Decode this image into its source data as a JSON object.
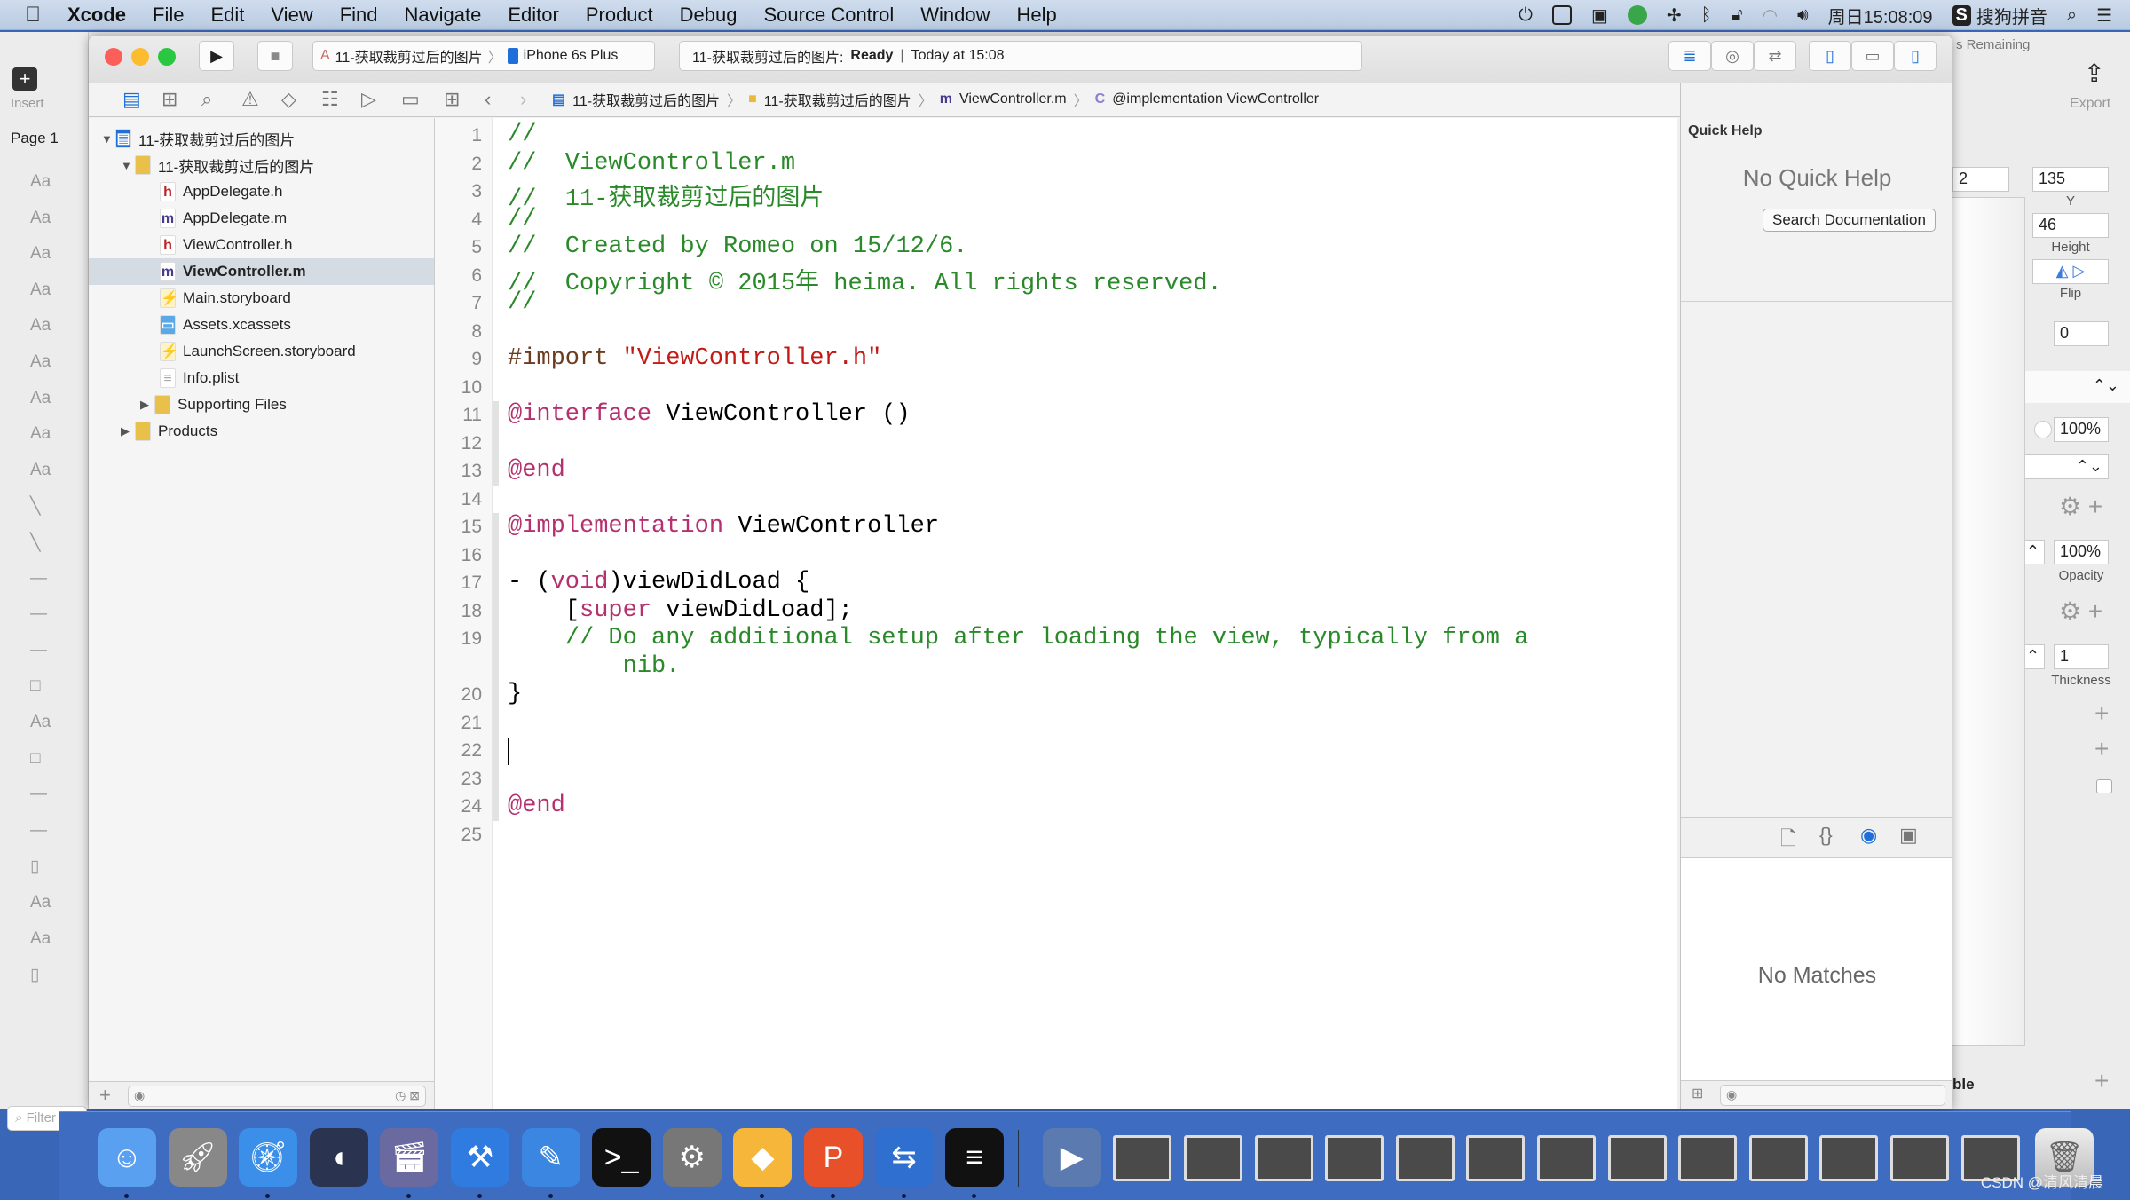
{
  "menubar": {
    "app": "Xcode",
    "items": [
      "File",
      "Edit",
      "View",
      "Find",
      "Navigate",
      "Editor",
      "Product",
      "Debug",
      "Source Control",
      "Window",
      "Help"
    ],
    "clock": "周日15:08:09",
    "ime": "搜狗拼音"
  },
  "sketch_left": {
    "insert": "Insert",
    "page": "Page 1",
    "filter_placeholder": "Filter",
    "aa": "Aa"
  },
  "sketch_right": {
    "remaining": "s Remaining",
    "export": "Export",
    "x_value": "2",
    "y_value": "135",
    "y_label": "Y",
    "height_value": "46",
    "height_label": "Height",
    "flip_label": "Flip",
    "radius_value": "0",
    "fill_opacity": "100%",
    "opacity_value": "100%",
    "opacity_label": "Opacity",
    "thickness_value": "1",
    "thickness_label": "Thickness",
    "bottom_label": "ble"
  },
  "toolbar": {
    "scheme": "11-获取裁剪过后的图片",
    "device": "iPhone 6s Plus",
    "status_project": "11-获取裁剪过后的图片:",
    "status_state": "Ready",
    "status_time": "Today at 15:08"
  },
  "jumpbar": {
    "crumbs": [
      "11-获取裁剪过后的图片",
      "11-获取裁剪过后的图片",
      "ViewController.m",
      "@implementation ViewController"
    ]
  },
  "navigator": {
    "items": [
      {
        "label": "11-获取裁剪过后的图片",
        "level": 0,
        "kind": "project",
        "open": true
      },
      {
        "label": "11-获取裁剪过后的图片",
        "level": 1,
        "kind": "folder",
        "open": true
      },
      {
        "label": "AppDelegate.h",
        "level": 2,
        "kind": "h"
      },
      {
        "label": "AppDelegate.m",
        "level": 2,
        "kind": "m"
      },
      {
        "label": "ViewController.h",
        "level": 2,
        "kind": "h"
      },
      {
        "label": "ViewController.m",
        "level": 2,
        "kind": "m",
        "selected": true
      },
      {
        "label": "Main.storyboard",
        "level": 2,
        "kind": "storyboard"
      },
      {
        "label": "Assets.xcassets",
        "level": 2,
        "kind": "assets"
      },
      {
        "label": "LaunchScreen.storyboard",
        "level": 2,
        "kind": "storyboard"
      },
      {
        "label": "Info.plist",
        "level": 2,
        "kind": "plist"
      },
      {
        "label": "Supporting Files",
        "level": 2,
        "kind": "folder",
        "open": false
      },
      {
        "label": "Products",
        "level": 1,
        "kind": "folder",
        "open": false
      }
    ]
  },
  "editor": {
    "lines": [
      {
        "n": "1",
        "t": [
          [
            "c",
            "//"
          ]
        ]
      },
      {
        "n": "2",
        "t": [
          [
            "c",
            "//  ViewController.m"
          ]
        ]
      },
      {
        "n": "3",
        "t": [
          [
            "c",
            "//  11-获取裁剪过后的图片"
          ]
        ]
      },
      {
        "n": "4",
        "t": [
          [
            "c",
            "//"
          ]
        ]
      },
      {
        "n": "5",
        "t": [
          [
            "c",
            "//  Created by Romeo on 15/12/6."
          ]
        ]
      },
      {
        "n": "6",
        "t": [
          [
            "c",
            "//  Copyright © 2015年 heima. All rights reserved."
          ]
        ]
      },
      {
        "n": "7",
        "t": [
          [
            "c",
            "//"
          ]
        ]
      },
      {
        "n": "8",
        "t": []
      },
      {
        "n": "9",
        "t": [
          [
            "p",
            "#import "
          ],
          [
            "s",
            "\"ViewController.h\""
          ]
        ]
      },
      {
        "n": "10",
        "t": []
      },
      {
        "n": "11",
        "t": [
          [
            "k",
            "@interface"
          ],
          [
            "n",
            " ViewController ()"
          ]
        ]
      },
      {
        "n": "12",
        "t": []
      },
      {
        "n": "13",
        "t": [
          [
            "k",
            "@end"
          ]
        ]
      },
      {
        "n": "14",
        "t": []
      },
      {
        "n": "15",
        "t": [
          [
            "k",
            "@implementation"
          ],
          [
            "n",
            " ViewController"
          ]
        ]
      },
      {
        "n": "16",
        "t": []
      },
      {
        "n": "17",
        "t": [
          [
            "n",
            "- ("
          ],
          [
            "k",
            "void"
          ],
          [
            "n",
            ")viewDidLoad {"
          ]
        ]
      },
      {
        "n": "18",
        "t": [
          [
            "n",
            "    ["
          ],
          [
            "k",
            "super"
          ],
          [
            "n",
            " viewDidLoad];"
          ]
        ]
      },
      {
        "n": "19",
        "t": [
          [
            "c",
            "    // Do any additional setup after loading the view, typically from a"
          ]
        ]
      },
      {
        "n": "",
        "t": [
          [
            "c",
            "        nib."
          ]
        ]
      },
      {
        "n": "20",
        "t": [
          [
            "n",
            "}"
          ]
        ]
      },
      {
        "n": "21",
        "t": []
      },
      {
        "n": "22",
        "t": [],
        "cursor": true
      },
      {
        "n": "23",
        "t": []
      },
      {
        "n": "24",
        "t": [
          [
            "k",
            "@end"
          ]
        ]
      },
      {
        "n": "25",
        "t": []
      }
    ]
  },
  "inspector": {
    "title": "Quick Help",
    "empty": "No Quick Help",
    "search_button": "Search Documentation",
    "library_empty": "No Matches"
  },
  "dock": {
    "apps": [
      "finder",
      "launchpad",
      "safari",
      "mouse",
      "imovie",
      "xcode",
      "instruments",
      "terminal",
      "system-preferences",
      "sketch",
      "presentation",
      "teamviewer",
      "console",
      "quicktime"
    ],
    "window_count": 13,
    "watermark": "CSDN @清风清晨"
  },
  "colors": {
    "comment": "#2a8a2a",
    "keyword": "#b5306e",
    "string": "#c41a16",
    "preprocessor": "#6b3c1e",
    "selection": "#d4dbe3",
    "accent": "#1e6fd9",
    "dock": "#3d6cc0"
  }
}
